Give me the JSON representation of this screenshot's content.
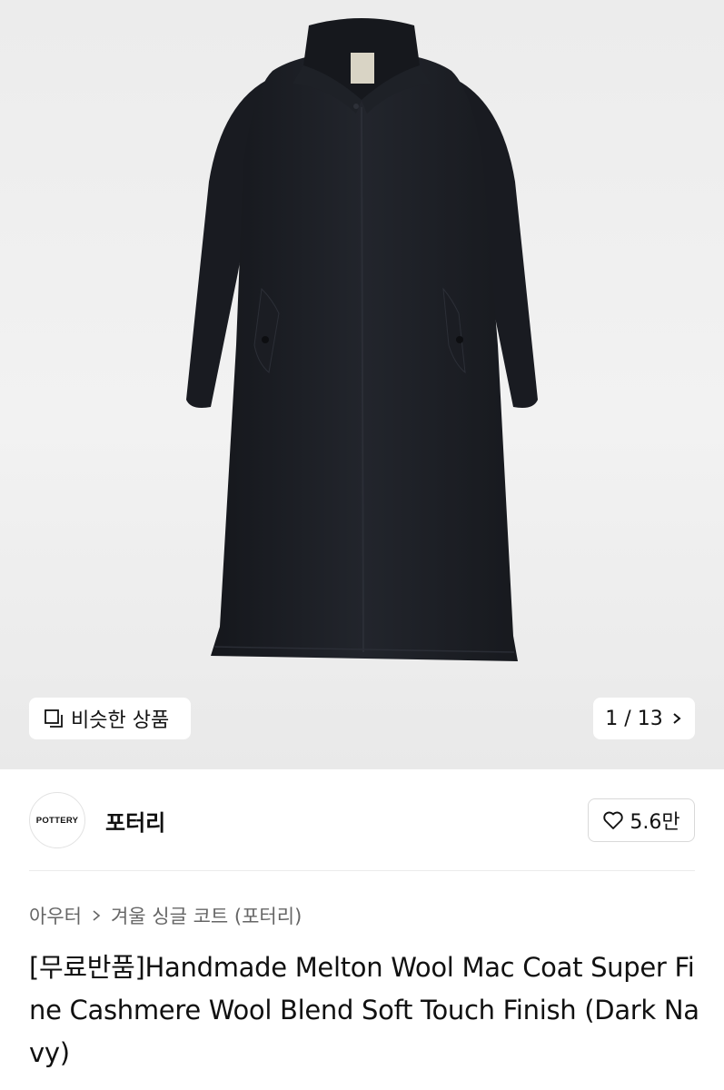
{
  "product_image": {
    "alt": "Dark navy long mac coat",
    "colors": {
      "coat": "#1c1e24",
      "background": "#eeeeee"
    }
  },
  "gallery": {
    "similar_label": "비슷한 상품",
    "similar_icon": "similar-items-icon",
    "current": "1",
    "total": "13",
    "pager_text": "1 / 13",
    "next_icon": "chevron-right-icon"
  },
  "brand": {
    "logo_text": "POTTERY",
    "name": "포터리",
    "like_icon": "heart-icon",
    "like_count": "5.6만"
  },
  "breadcrumb": {
    "items": [
      "아우터",
      "겨울 싱글 코트 (포터리)"
    ],
    "separator_icon": "chevron-right-icon"
  },
  "product": {
    "title": "[무료반품]Handmade Melton Wool Mac Coat Super Fine Cashmere Wool Blend Soft Touch Finish (Dark Navy)"
  }
}
